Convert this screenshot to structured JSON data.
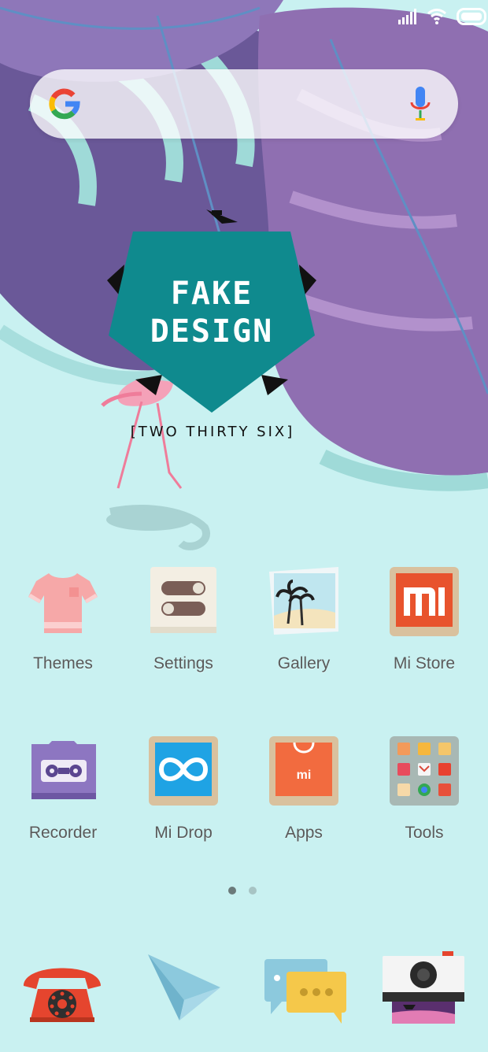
{
  "status_bar": {
    "icons": [
      "signal-icon",
      "wifi-icon",
      "battery-icon"
    ]
  },
  "search": {
    "icons": [
      "google-g-icon",
      "microphone-icon"
    ]
  },
  "wallpaper": {
    "logo_title_line1": "FAKE",
    "logo_title_line2": "DESIGN",
    "logo_tagline": "[TWO THIRTY SIX]",
    "colors": {
      "sky": "#c9f1f1",
      "leaf_dark": "#6b5699",
      "leaf_light": "#8f6fb1",
      "leaf_teal": "#9fdad8",
      "logo": "#0f8a8e"
    }
  },
  "apps": [
    {
      "label": "Themes",
      "icon": "tshirt-icon"
    },
    {
      "label": "Settings",
      "icon": "toggles-icon"
    },
    {
      "label": "Gallery",
      "icon": "palm-tree-photo-icon"
    },
    {
      "label": "Mi Store",
      "icon": "mi-logo-icon"
    },
    {
      "label": "Recorder",
      "icon": "cassette-icon"
    },
    {
      "label": "Mi Drop",
      "icon": "infinity-icon"
    },
    {
      "label": "Apps",
      "icon": "shopping-bag-icon"
    },
    {
      "label": "Tools",
      "icon": "folder-grid-icon"
    }
  ],
  "page_indicator": {
    "count": 2,
    "active": 1
  },
  "dock": [
    {
      "icon": "phone-icon"
    },
    {
      "icon": "paper-plane-icon"
    },
    {
      "icon": "chat-bubbles-icon"
    },
    {
      "icon": "camera-icon"
    }
  ]
}
